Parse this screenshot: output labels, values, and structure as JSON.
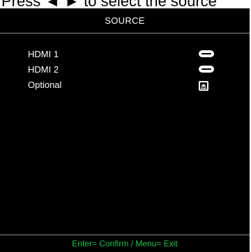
{
  "top_caption": "Press ◄ ► to select the source",
  "osd": {
    "title": "SOURCE",
    "items": [
      {
        "label": "HDMI 1",
        "icon": "hdmi-connector-icon"
      },
      {
        "label": "HDMI 2",
        "icon": "hdmi-connector-icon"
      },
      {
        "label": "Optional",
        "icon": "optional-source-icon"
      }
    ],
    "footer": "Enter= Confirm / Menu= Exit"
  },
  "colors": {
    "background": "#000000",
    "text": "#ffffff",
    "footer_text": "#19c24a",
    "divider": "#8a8a8a"
  }
}
